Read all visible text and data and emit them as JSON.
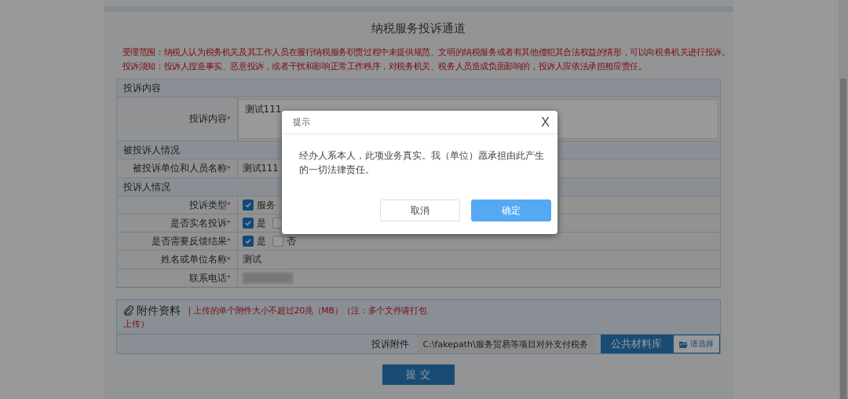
{
  "page": {
    "title": "纳税服务投诉通道",
    "notices": [
      "受理范围：纳税人认为税务机关及其工作人员在履行纳税服务职责过程中未提供规范、文明的纳税服务或者有其他侵犯其合法权益的情形，可以向税务机关进行投诉。",
      "投诉须知：投诉人捏造事实、恶意投诉，或者干扰和影响正常工作秩序，对税务机关、税务人员造成负面影响的，投诉人应依法承担相应责任。"
    ]
  },
  "form": {
    "sections": [
      {
        "title": "投诉内容",
        "rows": [
          {
            "kind": "textarea",
            "label": "投诉内容",
            "required_mark": "*",
            "value": "测试111"
          }
        ]
      },
      {
        "title": "被投诉人情况",
        "rows": [
          {
            "kind": "text",
            "label": "被投诉单位和人员名称",
            "required_mark": "*",
            "value": "测试111"
          }
        ]
      },
      {
        "title": "投诉人情况",
        "rows": [
          {
            "kind": "checks",
            "label": "投诉类型",
            "required_mark": "*",
            "options": [
              {
                "label": "服务",
                "checked": true
              }
            ]
          },
          {
            "kind": "checks",
            "label": "是否实名投诉",
            "required_mark": "*",
            "options": [
              {
                "label": "是",
                "checked": true
              },
              {
                "checked": false
              }
            ]
          },
          {
            "kind": "checks",
            "label": "是否需要反馈结果",
            "required_mark": "*",
            "options": [
              {
                "label": "是",
                "checked": true
              },
              {
                "label": "否",
                "checked": false
              }
            ]
          },
          {
            "kind": "text",
            "label": "姓名或单位名称",
            "required_mark": "*",
            "value": "测试"
          },
          {
            "kind": "redacted",
            "label": "联系电话",
            "required_mark": "*"
          }
        ]
      }
    ]
  },
  "attachments": {
    "title": "附件资料",
    "notice_lines": [
      "| 上传的单个附件大小不超过20兆（MB）（注：多个文件请打包",
      "上传）"
    ],
    "label": "投诉附件",
    "file_value": "C:\\fakepath\\服务贸易等项目对外支付税务",
    "library_button": "公共材料库",
    "choose_button": "请选择"
  },
  "submit_button": "提 交",
  "dialog": {
    "title": "提示",
    "close": "X",
    "message": "经办人系本人，此项业务真实。我（单位）愿承担由此产生的一切法律责任。",
    "buttons": [
      {
        "label": "取消",
        "kind": "secondary"
      },
      {
        "label": "确定",
        "kind": "primary"
      }
    ]
  }
}
